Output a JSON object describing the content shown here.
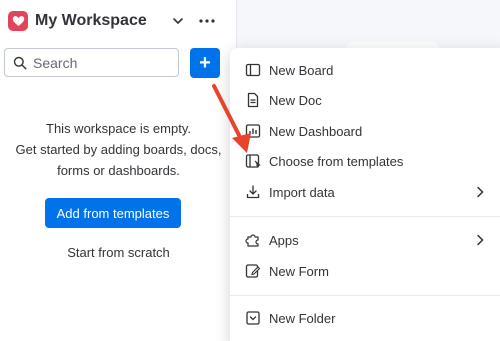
{
  "workspace": {
    "title": "My Workspace",
    "logo_color": "#e2445c"
  },
  "search": {
    "placeholder": "Search",
    "value": ""
  },
  "add_button": {
    "label": "+",
    "color": "#0073ea"
  },
  "empty_state": {
    "line1": "This workspace is empty.",
    "line2": "Get started by adding boards, docs,",
    "line3": "forms or dashboards.",
    "primary_button": "Add from templates",
    "secondary_link": "Start from scratch"
  },
  "menu": {
    "items": [
      {
        "label": "New Board",
        "icon": "board-icon"
      },
      {
        "label": "New Doc",
        "icon": "doc-icon"
      },
      {
        "label": "New Dashboard",
        "icon": "dashboard-icon"
      },
      {
        "label": "Choose from templates",
        "icon": "templates-icon"
      },
      {
        "label": "Import data",
        "icon": "import-icon",
        "submenu": true
      },
      {
        "label": "Apps",
        "icon": "apps-icon",
        "submenu": true
      },
      {
        "label": "New Form",
        "icon": "form-icon"
      },
      {
        "label": "New Folder",
        "icon": "folder-icon"
      }
    ]
  },
  "colors": {
    "accent": "#0073ea",
    "annotation_arrow": "#e8432b"
  }
}
